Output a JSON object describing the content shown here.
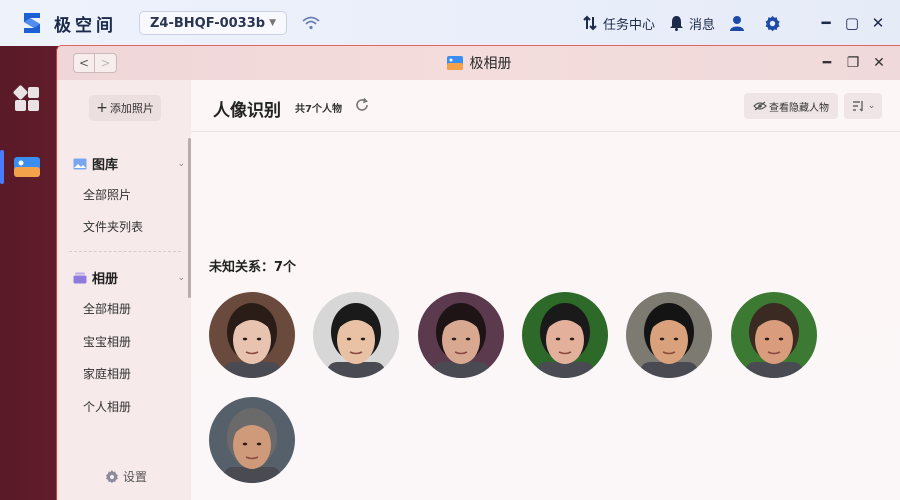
{
  "topbar": {
    "brand": "极空间",
    "device": "Z4-BHQF-0033b",
    "tasks_label": "任务中心",
    "messages_label": "消息"
  },
  "window": {
    "title": "极相册"
  },
  "sidebar": {
    "add_photos": "添加照片",
    "gallery_group": "图库",
    "gallery_items": [
      "全部照片",
      "文件夹列表"
    ],
    "album_group": "相册",
    "album_items": [
      "全部相册",
      "宝宝相册",
      "家庭相册",
      "个人相册"
    ],
    "settings": "设置"
  },
  "main": {
    "title": "人像识别",
    "count": "共7个人物",
    "view_hidden": "查看隐藏人物",
    "section_label": "未知关系：7个",
    "faces": [
      {
        "skin": "#e8c4b0",
        "hair": "#2a1d18",
        "bg": "#6a4a3c"
      },
      {
        "skin": "#e9c2a6",
        "hair": "#1a1a1a",
        "bg": "#d7d7d7"
      },
      {
        "skin": "#d8a891",
        "hair": "#1e1416",
        "bg": "#5c3a4e"
      },
      {
        "skin": "#e3b09c",
        "hair": "#1a1a1a",
        "bg": "#2d6a2a"
      },
      {
        "skin": "#d9a27c",
        "hair": "#141414",
        "bg": "#7d7a72"
      },
      {
        "skin": "#d99c7c",
        "hair": "#3a2a22",
        "bg": "#3c7a34"
      },
      {
        "skin": "#cf9a7a",
        "hair": "#6a6a6a",
        "bg": "#56606a"
      }
    ]
  }
}
